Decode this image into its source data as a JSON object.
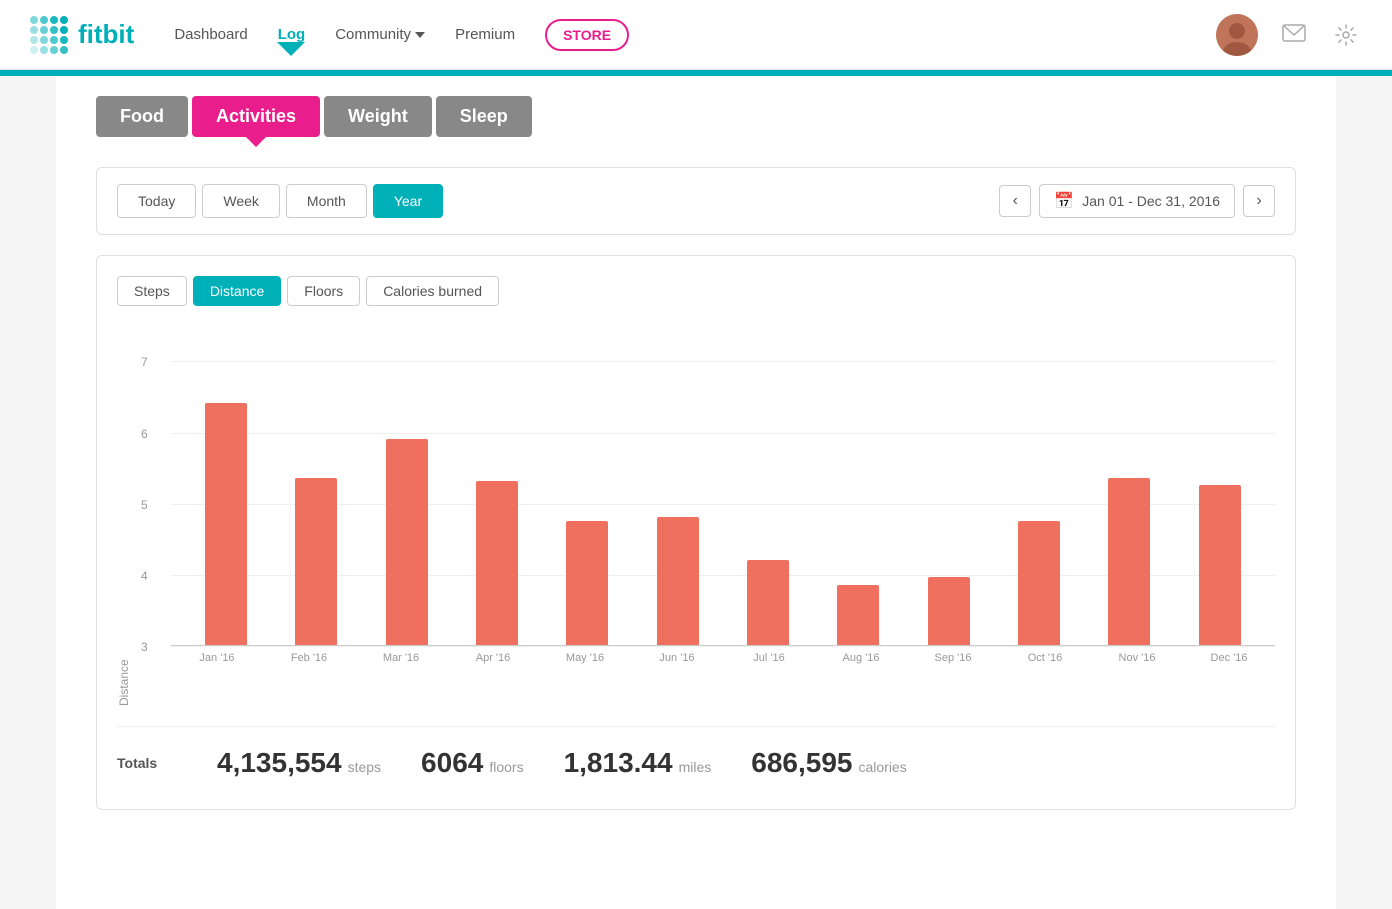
{
  "brand": {
    "name": "fitbit"
  },
  "navbar": {
    "links": [
      {
        "label": "Dashboard",
        "active": false
      },
      {
        "label": "Log",
        "active": true
      },
      {
        "label": "Community",
        "active": false,
        "hasDropdown": true
      },
      {
        "label": "Premium",
        "active": false
      }
    ],
    "store_label": "STORE",
    "icons": {
      "message": "💬",
      "settings": "⚙"
    }
  },
  "sub_tabs": [
    {
      "label": "Food",
      "active": false
    },
    {
      "label": "Activities",
      "active": true
    },
    {
      "label": "Weight",
      "active": false
    },
    {
      "label": "Sleep",
      "active": false
    }
  ],
  "period_buttons": [
    {
      "label": "Today",
      "active": false
    },
    {
      "label": "Week",
      "active": false
    },
    {
      "label": "Month",
      "active": false
    },
    {
      "label": "Year",
      "active": true
    }
  ],
  "date_range": "Jan 01 - Dec 31, 2016",
  "chart_tabs": [
    {
      "label": "Steps",
      "active": false
    },
    {
      "label": "Distance",
      "active": true
    },
    {
      "label": "Floors",
      "active": false
    },
    {
      "label": "Calories burned",
      "active": false
    }
  ],
  "y_axis": {
    "label": "Distance",
    "values": [
      3,
      4,
      5,
      6,
      7
    ]
  },
  "bars": [
    {
      "month": "Jan '16",
      "value": 6.4
    },
    {
      "month": "Feb '16",
      "value": 5.35
    },
    {
      "month": "Mar '16",
      "value": 5.9
    },
    {
      "month": "Apr '16",
      "value": 5.3
    },
    {
      "month": "May '16",
      "value": 4.75
    },
    {
      "month": "Jun '16",
      "value": 4.8
    },
    {
      "month": "Jul '16",
      "value": 4.2
    },
    {
      "month": "Aug '16",
      "value": 3.85
    },
    {
      "month": "Sep '16",
      "value": 3.95
    },
    {
      "month": "Oct '16",
      "value": 4.75
    },
    {
      "month": "Nov '16",
      "value": 5.35
    },
    {
      "month": "Dec '16",
      "value": 5.25
    }
  ],
  "chart_y_min": 3,
  "chart_y_max": 7.5,
  "totals": {
    "label": "Totals",
    "items": [
      {
        "value": "4,135,554",
        "unit": "steps"
      },
      {
        "value": "6064",
        "unit": "floors"
      },
      {
        "value": "1,813.44",
        "unit": "miles"
      },
      {
        "value": "686,595",
        "unit": "calories"
      }
    ]
  }
}
